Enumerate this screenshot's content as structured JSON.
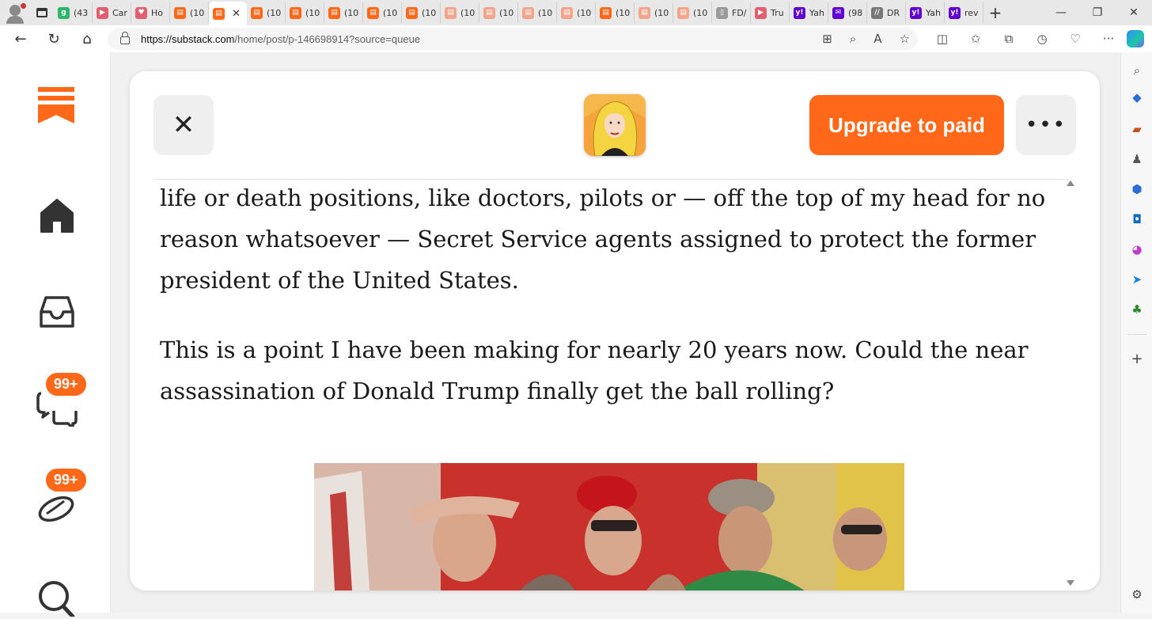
{
  "browser": {
    "tabs": [
      {
        "label": "(43",
        "color": "#2fb46b",
        "glyph": "g"
      },
      {
        "label": "Car",
        "color": "#e06070",
        "glyph": "▶"
      },
      {
        "label": "Ho",
        "color": "#e06070",
        "glyph": "♥"
      },
      {
        "label": "(10",
        "color": "#ff6719",
        "glyph": "▤"
      },
      {
        "label": "",
        "color": "#ff6719",
        "glyph": "▤",
        "active": true
      },
      {
        "label": "(10",
        "color": "#ff6719",
        "glyph": "▤"
      },
      {
        "label": "(10",
        "color": "#ff6719",
        "glyph": "▤"
      },
      {
        "label": "(10",
        "color": "#ff6719",
        "glyph": "▤"
      },
      {
        "label": "(10",
        "color": "#ff6719",
        "glyph": "▤"
      },
      {
        "label": "(10",
        "color": "#ff6719",
        "glyph": "▤"
      },
      {
        "label": "(10",
        "color": "#f2a58a",
        "glyph": "▤"
      },
      {
        "label": "(10",
        "color": "#f2a58a",
        "glyph": "▤"
      },
      {
        "label": "(10",
        "color": "#f2a58a",
        "glyph": "▤"
      },
      {
        "label": "(10",
        "color": "#f2a58a",
        "glyph": "▤"
      },
      {
        "label": "(10",
        "color": "#ff6719",
        "glyph": "▤"
      },
      {
        "label": "(10",
        "color": "#f2a58a",
        "glyph": "▤"
      },
      {
        "label": "(10",
        "color": "#f2a58a",
        "glyph": "▤"
      },
      {
        "label": "FD/",
        "color": "#9a9a9a",
        "glyph": "▯"
      },
      {
        "label": "Tru",
        "color": "#e06070",
        "glyph": "▶"
      },
      {
        "label": "Yah",
        "color": "#6001d2",
        "glyph": "y!"
      },
      {
        "label": "(98",
        "color": "#6001d2",
        "glyph": "✉"
      },
      {
        "label": "DR",
        "color": "#777777",
        "glyph": "//"
      },
      {
        "label": "Yah",
        "color": "#6001d2",
        "glyph": "y!"
      },
      {
        "label": "rev",
        "color": "#6001d2",
        "glyph": "y!"
      }
    ],
    "url_host": "https://substack.com",
    "url_path": "/home/post/p-146698914?source=queue"
  },
  "sidebar": {
    "chat_badge": "99+",
    "activity_badge": "99+"
  },
  "header": {
    "close_glyph": "✕",
    "upgrade_label": "Upgrade to paid",
    "more_glyph": "•••"
  },
  "article": {
    "paragraph_1": "life or death positions, like doctors, pilots or — off the top of my head for no reason whatsoever — Secret Service agents assigned to protect the former president of the United States.",
    "paragraph_2": "This is a point I have been making for nearly 20 years now. Could the near assassination of Donald Trump finally get the ball rolling?"
  },
  "colors": {
    "brand": "#ff6719",
    "text": "#1a1a1a"
  }
}
